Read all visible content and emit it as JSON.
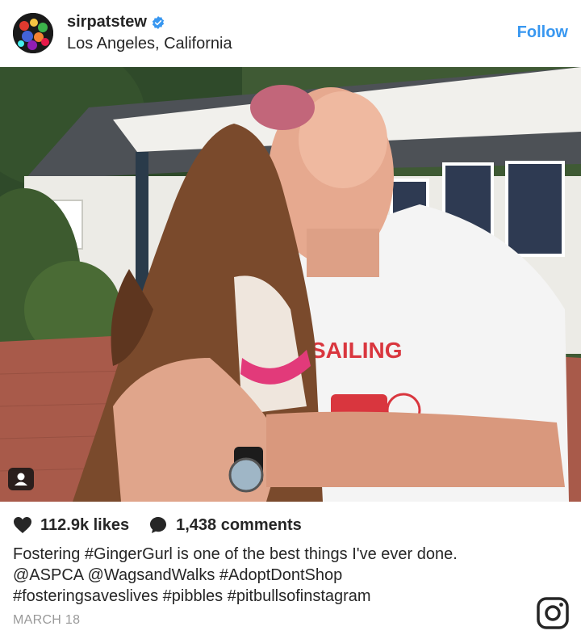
{
  "header": {
    "username": "sirpatstew",
    "verified_icon": "verified-badge-icon",
    "location": "Los Angeles, California",
    "follow_label": "Follow"
  },
  "photo": {
    "tag_icon": "user-tag-icon"
  },
  "stats": {
    "likes": "112.9k likes",
    "comments": "1,438 comments",
    "like_icon": "heart-icon",
    "comment_icon": "comment-bubble-icon"
  },
  "caption": {
    "lines": [
      "Fostering #GingerGurl is one of the best things I've ever done.",
      "@ASPCA @WagsandWalks #AdoptDontShop",
      "#fosteringsaveslives #pibbles #pitbullsofinstagram"
    ]
  },
  "date": "MARCH 18",
  "colors": {
    "accent": "#3897f0",
    "text": "#262626",
    "muted": "#999999"
  }
}
